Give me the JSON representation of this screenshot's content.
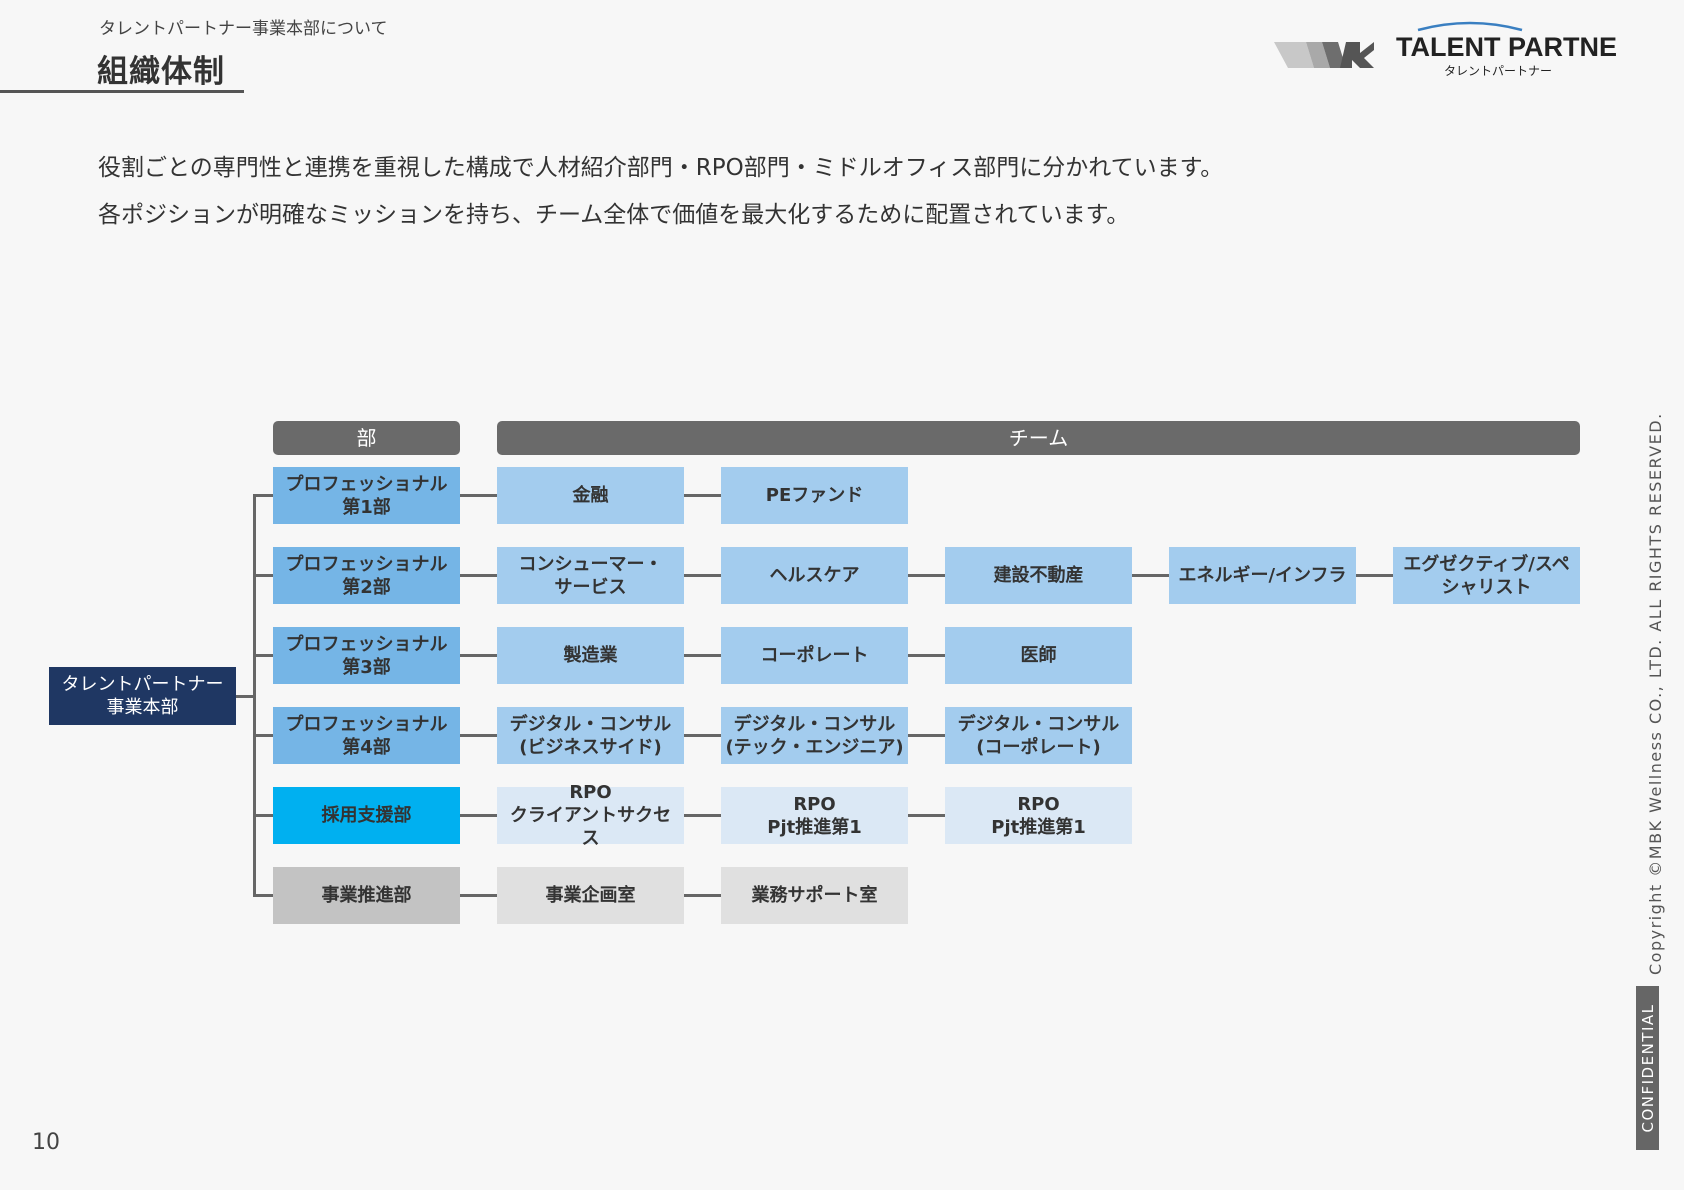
{
  "header": {
    "breadcrumb": "タレントパートナー事業本部について",
    "title": "組織体制",
    "logo_text": "TALENT PARTNER",
    "logo_subtext": "タレントパートナー"
  },
  "intro": {
    "line1": "役割ごとの専門性と連携を重視した構成で人材紹介部門・RPO部門・ミドルオフィス部門に分かれています。",
    "line2": "各ポジションが明確なミッションを持ち、チーム全体で価値を最大化するために配置されています。"
  },
  "org_chart": {
    "headers": {
      "dept": "部",
      "team": "チーム"
    },
    "root": "タレントパートナー\n事業本部",
    "rows": [
      {
        "dept": "プロフェッショナル\n第1部",
        "teams": [
          "金融",
          "PEファンド"
        ]
      },
      {
        "dept": "プロフェッショナル\n第2部",
        "teams": [
          "コンシューマー・\nサービス",
          "ヘルスケア",
          "建設不動産",
          "エネルギー/インフラ",
          "エグゼクティブ/スペ\nシャリスト"
        ]
      },
      {
        "dept": "プロフェッショナル\n第3部",
        "teams": [
          "製造業",
          "コーポレート",
          "医師"
        ]
      },
      {
        "dept": "プロフェッショナル\n第4部",
        "teams": [
          "デジタル・コンサル\n(ビジネスサイド)",
          "デジタル・コンサル\n(テック・エンジニア)",
          "デジタル・コンサル\n(コーポレート)"
        ]
      },
      {
        "dept": "採用支援部",
        "teams": [
          "RPO\nクライアントサクセス",
          "RPO\nPjt推進第1",
          "RPO\nPjt推進第1"
        ]
      },
      {
        "dept": "事業推進部",
        "teams": [
          "事業企画室",
          "業務サポート室"
        ]
      }
    ],
    "colors": {
      "root": "#1f3763",
      "dept_professional": "#75b5e6",
      "dept_recruiting": "#00b0f0",
      "dept_business": "#c3c3c3",
      "team_professional": "#a3ccee",
      "team_rpo": "#dbe8f5",
      "team_business": "#e0e0e0",
      "header": "#6a6a6a"
    }
  },
  "footer": {
    "copyright": "Copyright ©MBK Wellness CO., LTD. ALL RIGHTS RESERVED.",
    "confidential": "CONFIDENTIAL",
    "page_number": "10"
  }
}
